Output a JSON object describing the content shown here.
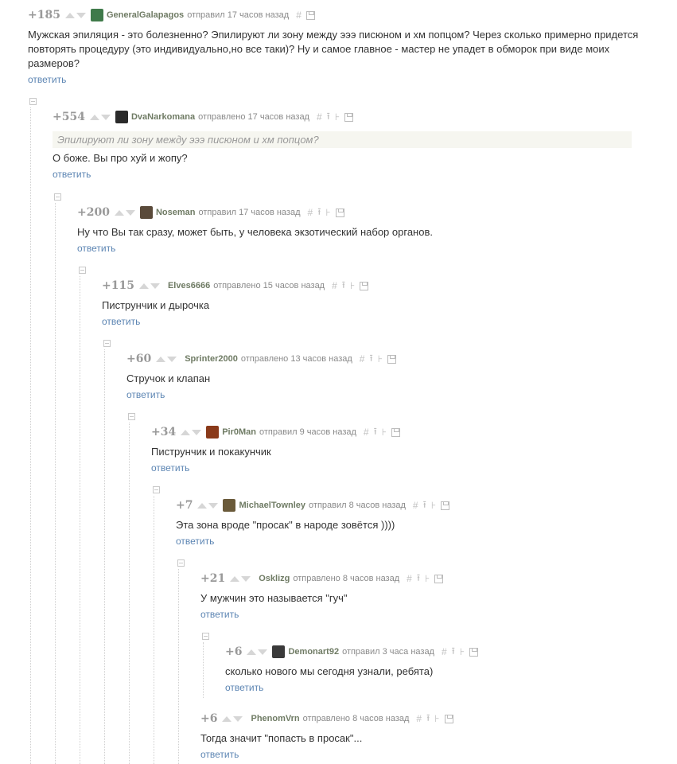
{
  "comments": [
    {
      "rating": "+185",
      "author": "GeneralGalapagos",
      "meta": "отправил 17 часов назад",
      "avatar_color": "#3f7a4a",
      "text": "Мужская эпиляция - это болезненно? Эпилируют ли зону между эээ писюном и хм попцом? Через сколько примерно придется повторять процедуру (это индивидуально,но все таки)? Ну и самое главное - мастер не упадет в обморок при виде моих размеров?",
      "reply": "ответить"
    },
    {
      "rating": "+554",
      "author": "DvaNarkomana",
      "meta": "отправлено 17 часов назад",
      "avatar_color": "#2a2a2a",
      "quote": "Эпилируют ли зону между эээ писюном и хм попцом?",
      "text": "О боже. Вы про хуй и жопу?",
      "reply": "ответить"
    },
    {
      "rating": "+200",
      "author": "Noseman",
      "meta": "отправил 17 часов назад",
      "avatar_color": "#5a4a3a",
      "text": "Ну что Вы так сразу, может быть, у человека экзотический набор органов.",
      "reply": "ответить"
    },
    {
      "rating": "+115",
      "author": "Elves6666",
      "meta": "отправлено 15 часов назад",
      "text": "Пиструнчик и дырочка",
      "reply": "ответить"
    },
    {
      "rating": "+60",
      "author": "Sprinter2000",
      "meta": "отправлено 13 часов назад",
      "text": "Стручок и клапан",
      "reply": "ответить"
    },
    {
      "rating": "+34",
      "author": "Pir0Man",
      "meta": "отправил 9 часов назад",
      "avatar_color": "#8a3a1a",
      "text": "Пиструнчик и покакунчик",
      "reply": "ответить"
    },
    {
      "rating": "+7",
      "author": "MichaelTownley",
      "meta": "отправил 8 часов назад",
      "avatar_color": "#6a5a3a",
      "text": "Эта зона вроде \"просак\" в народе зовётся ))))",
      "reply": "ответить"
    },
    {
      "rating": "+21",
      "author": "Osklizg",
      "meta": "отправлено 8 часов назад",
      "text": "У мужчин это называется \"гуч\"",
      "reply": "ответить"
    },
    {
      "rating": "+6",
      "author": "Demonart92",
      "meta": "отправил 3 часа назад",
      "avatar_color": "#3a3a3a",
      "text": "сколько нового мы сегодня узнали, ребята)",
      "reply": "ответить"
    },
    {
      "rating": "+6",
      "author": "PhenomVrn",
      "meta": "отправлено 8 часов назад",
      "text": "Тогда значит \"попасть в просак\"...",
      "reply": "ответить"
    }
  ]
}
